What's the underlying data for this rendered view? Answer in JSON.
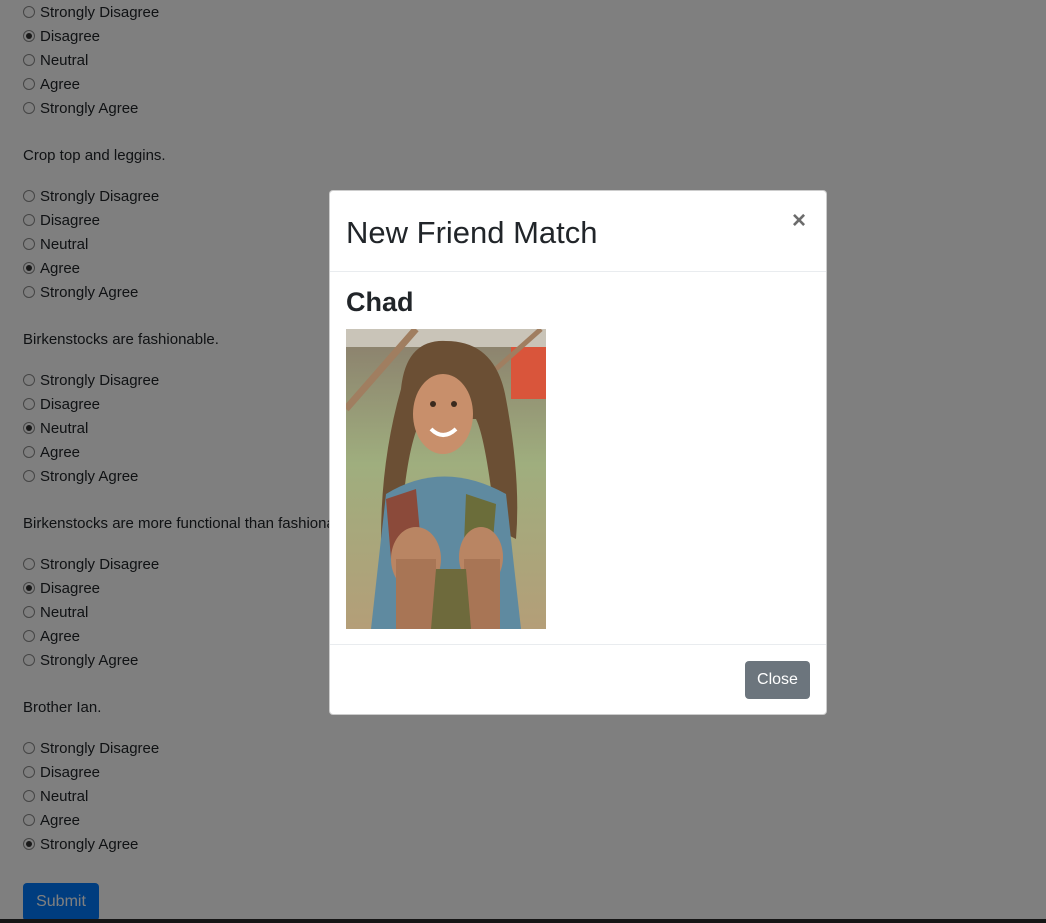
{
  "survey": {
    "first_question": {
      "options": [
        {
          "label": "Strongly Disagree",
          "checked": false
        },
        {
          "label": "Disagree",
          "checked": true
        },
        {
          "label": "Neutral",
          "checked": false
        },
        {
          "label": "Agree",
          "checked": false
        },
        {
          "label": "Strongly Agree",
          "checked": false
        }
      ]
    },
    "questions": [
      {
        "text": "Crop top and leggins.",
        "options": [
          {
            "label": "Strongly Disagree",
            "checked": false
          },
          {
            "label": "Disagree",
            "checked": false
          },
          {
            "label": "Neutral",
            "checked": false
          },
          {
            "label": "Agree",
            "checked": true
          },
          {
            "label": "Strongly Agree",
            "checked": false
          }
        ]
      },
      {
        "text": "Birkenstocks are fashionable.",
        "options": [
          {
            "label": "Strongly Disagree",
            "checked": false
          },
          {
            "label": "Disagree",
            "checked": false
          },
          {
            "label": "Neutral",
            "checked": true
          },
          {
            "label": "Agree",
            "checked": false
          },
          {
            "label": "Strongly Agree",
            "checked": false
          }
        ]
      },
      {
        "text": "Birkenstocks are more functional than fashionable.",
        "options": [
          {
            "label": "Strongly Disagree",
            "checked": false
          },
          {
            "label": "Disagree",
            "checked": true
          },
          {
            "label": "Neutral",
            "checked": false
          },
          {
            "label": "Agree",
            "checked": false
          },
          {
            "label": "Strongly Agree",
            "checked": false
          }
        ]
      },
      {
        "text": "Brother Ian.",
        "options": [
          {
            "label": "Strongly Disagree",
            "checked": false
          },
          {
            "label": "Disagree",
            "checked": false
          },
          {
            "label": "Neutral",
            "checked": false
          },
          {
            "label": "Agree",
            "checked": false
          },
          {
            "label": "Strongly Agree",
            "checked": true
          }
        ]
      }
    ],
    "submit_label": "Submit"
  },
  "modal": {
    "title": "New Friend Match",
    "close_glyph": "×",
    "match_name": "Chad",
    "photo_icon": "person-photo",
    "close_button_label": "Close"
  },
  "colors": {
    "primary": "#007bff",
    "secondary": "#6c757d",
    "backdrop": "rgba(0,0,0,0.5)"
  }
}
